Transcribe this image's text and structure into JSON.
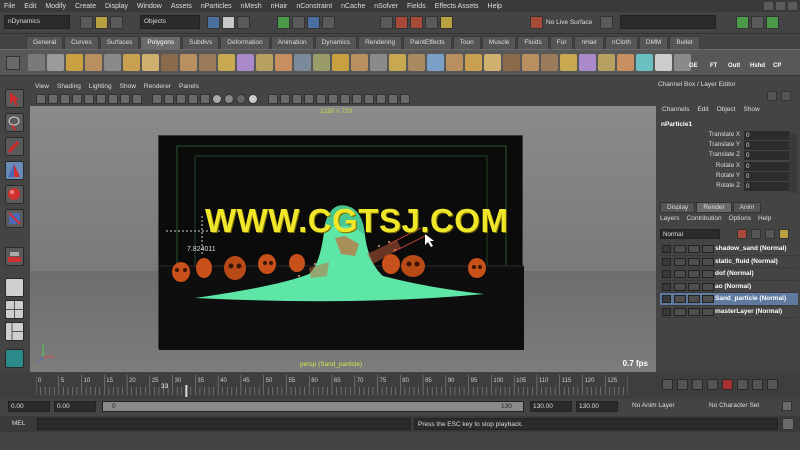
{
  "menubar": [
    "File",
    "Edit",
    "Modify",
    "Create",
    "Display",
    "Window",
    "Assets",
    "nParticles",
    "nMesh",
    "nHair",
    "nConstraint",
    "nCache",
    "nSolver",
    "Fields",
    "Effects Assets",
    "Help"
  ],
  "statusline": {
    "module": "nDynamics",
    "selection_mode": "Objects",
    "live_surface": "No Live Surface"
  },
  "shelf": {
    "tabs": [
      "General",
      "Curves",
      "Surfaces",
      "Polygons",
      "Subdivs",
      "Deformation",
      "Animation",
      "Dynamics",
      "Rendering",
      "PaintEffects",
      "Toon",
      "Muscle",
      "Fluids",
      "Fur",
      "nHair",
      "nCloth",
      "DMM",
      "Bullet"
    ],
    "active_tab": "Polygons",
    "labels": [
      "GE",
      "FT",
      "Outl",
      "Hshd",
      "CP"
    ]
  },
  "viewport": {
    "menu": [
      "View",
      "Shading",
      "Lighting",
      "Show",
      "Renderer",
      "Panels"
    ],
    "resolution": "1280 x 720",
    "camera": "persp (Sand_particle)",
    "fps": "0.7 fps",
    "measure": "7.824011",
    "watermark": "WWW.CGTSJ.COM"
  },
  "channelbox": {
    "title": "Channel Box / Layer Editor",
    "menu": [
      "Channels",
      "Edit",
      "Object",
      "Show"
    ],
    "object": "nParticle1",
    "attributes": [
      {
        "name": "Translate X",
        "value": "0"
      },
      {
        "name": "Translate Y",
        "value": "0"
      },
      {
        "name": "Translate Z",
        "value": "0"
      },
      {
        "name": "Rotate X",
        "value": "0"
      },
      {
        "name": "Rotate Y",
        "value": "0"
      },
      {
        "name": "Rotate Z",
        "value": "0"
      }
    ]
  },
  "layers": {
    "tabs": [
      "Display",
      "Render",
      "Anim"
    ],
    "active_tab": "Render",
    "menu": [
      "Layers",
      "Contribution",
      "Options",
      "Help"
    ],
    "mode": "Normal",
    "rows": [
      {
        "name": "shadow_sand (Normal)",
        "selected": false
      },
      {
        "name": "static_fluid (Normal)",
        "selected": false
      },
      {
        "name": "dof (Normal)",
        "selected": false
      },
      {
        "name": "ao (Normal)",
        "selected": false
      },
      {
        "name": "Sand_particle (Normal)",
        "selected": true
      },
      {
        "name": "masterLayer (Normal)",
        "selected": false
      }
    ]
  },
  "timeslider": {
    "ticks": [
      "0",
      "5",
      "10",
      "15",
      "20",
      "25",
      "30",
      "35",
      "40",
      "45",
      "50",
      "55",
      "60",
      "65",
      "70",
      "75",
      "80",
      "85",
      "90",
      "95",
      "100",
      "105",
      "110",
      "115",
      "120",
      "125",
      "130"
    ],
    "current_frame": "33",
    "current_fraction": 0.254
  },
  "rangeslider": {
    "start": "0.00",
    "range_start": "0.00",
    "range_min": "0",
    "range_max": "130",
    "range_end": "130.00",
    "end": "130.00",
    "anim_layer": "No Anim Layer",
    "character_set": "No Character Set"
  },
  "cmdline": {
    "label": "MEL",
    "result": "Press the ESC key to stop playback."
  },
  "colors": {
    "particles": "#5ee6a6",
    "skull": "#c8501a",
    "accent_yellow": "#f0e62a",
    "selected": "#5f7a9e"
  }
}
